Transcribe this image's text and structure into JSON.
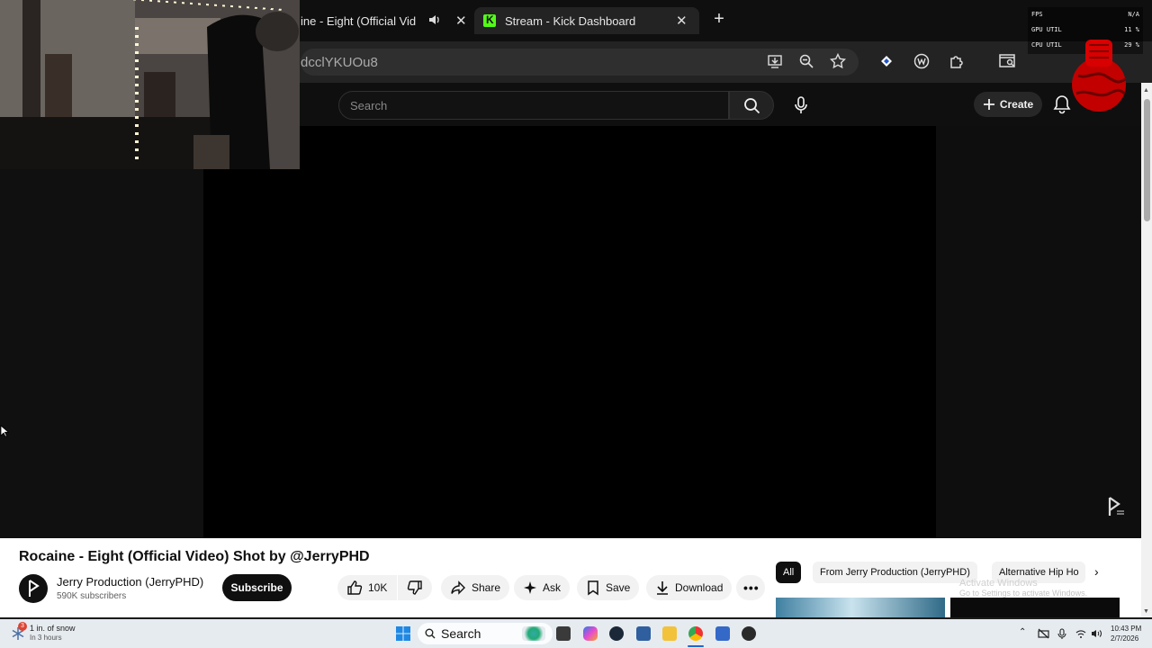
{
  "browser": {
    "tabs": [
      {
        "title": "ine - Eight (Official Vid"
      },
      {
        "title": "Stream - Kick Dashboard"
      }
    ],
    "url": "dcclYKUOu8"
  },
  "youtube": {
    "search_placeholder": "Search",
    "create_label": "Create",
    "video": {
      "title": "Rocaine - Eight (Official Video) Shot by @JerryPHD",
      "channel": "Jerry Production (JerryPHD)",
      "subscribers": "590K subscribers",
      "subscribe_label": "Subscribe",
      "likes": "10K",
      "share_label": "Share",
      "ask_label": "Ask",
      "save_label": "Save",
      "download_label": "Download"
    },
    "chips": [
      "All",
      "From Jerry Production (JerryPHD)",
      "Alternative Hip Ho"
    ]
  },
  "windows_watermark": {
    "line1": "Activate Windows",
    "line2": "Go to Settings to activate Windows."
  },
  "perf_overlay": {
    "rows": [
      {
        "label": "FPS",
        "value": "N/A"
      },
      {
        "label": "GPU UTIL",
        "value": "11 %"
      },
      {
        "label": "CPU UTIL",
        "value": "29 %"
      }
    ]
  },
  "taskbar": {
    "weather_line1": "1 in. of snow",
    "weather_line2": "In 3 hours",
    "weather_badge": "3",
    "search_label": "Search",
    "time": "10:43 PM",
    "date": "2/7/2026"
  },
  "colors": {
    "kick_green": "#53fc18",
    "youtube_dark": "#0f0f0f",
    "perf_red": "#d40000"
  }
}
